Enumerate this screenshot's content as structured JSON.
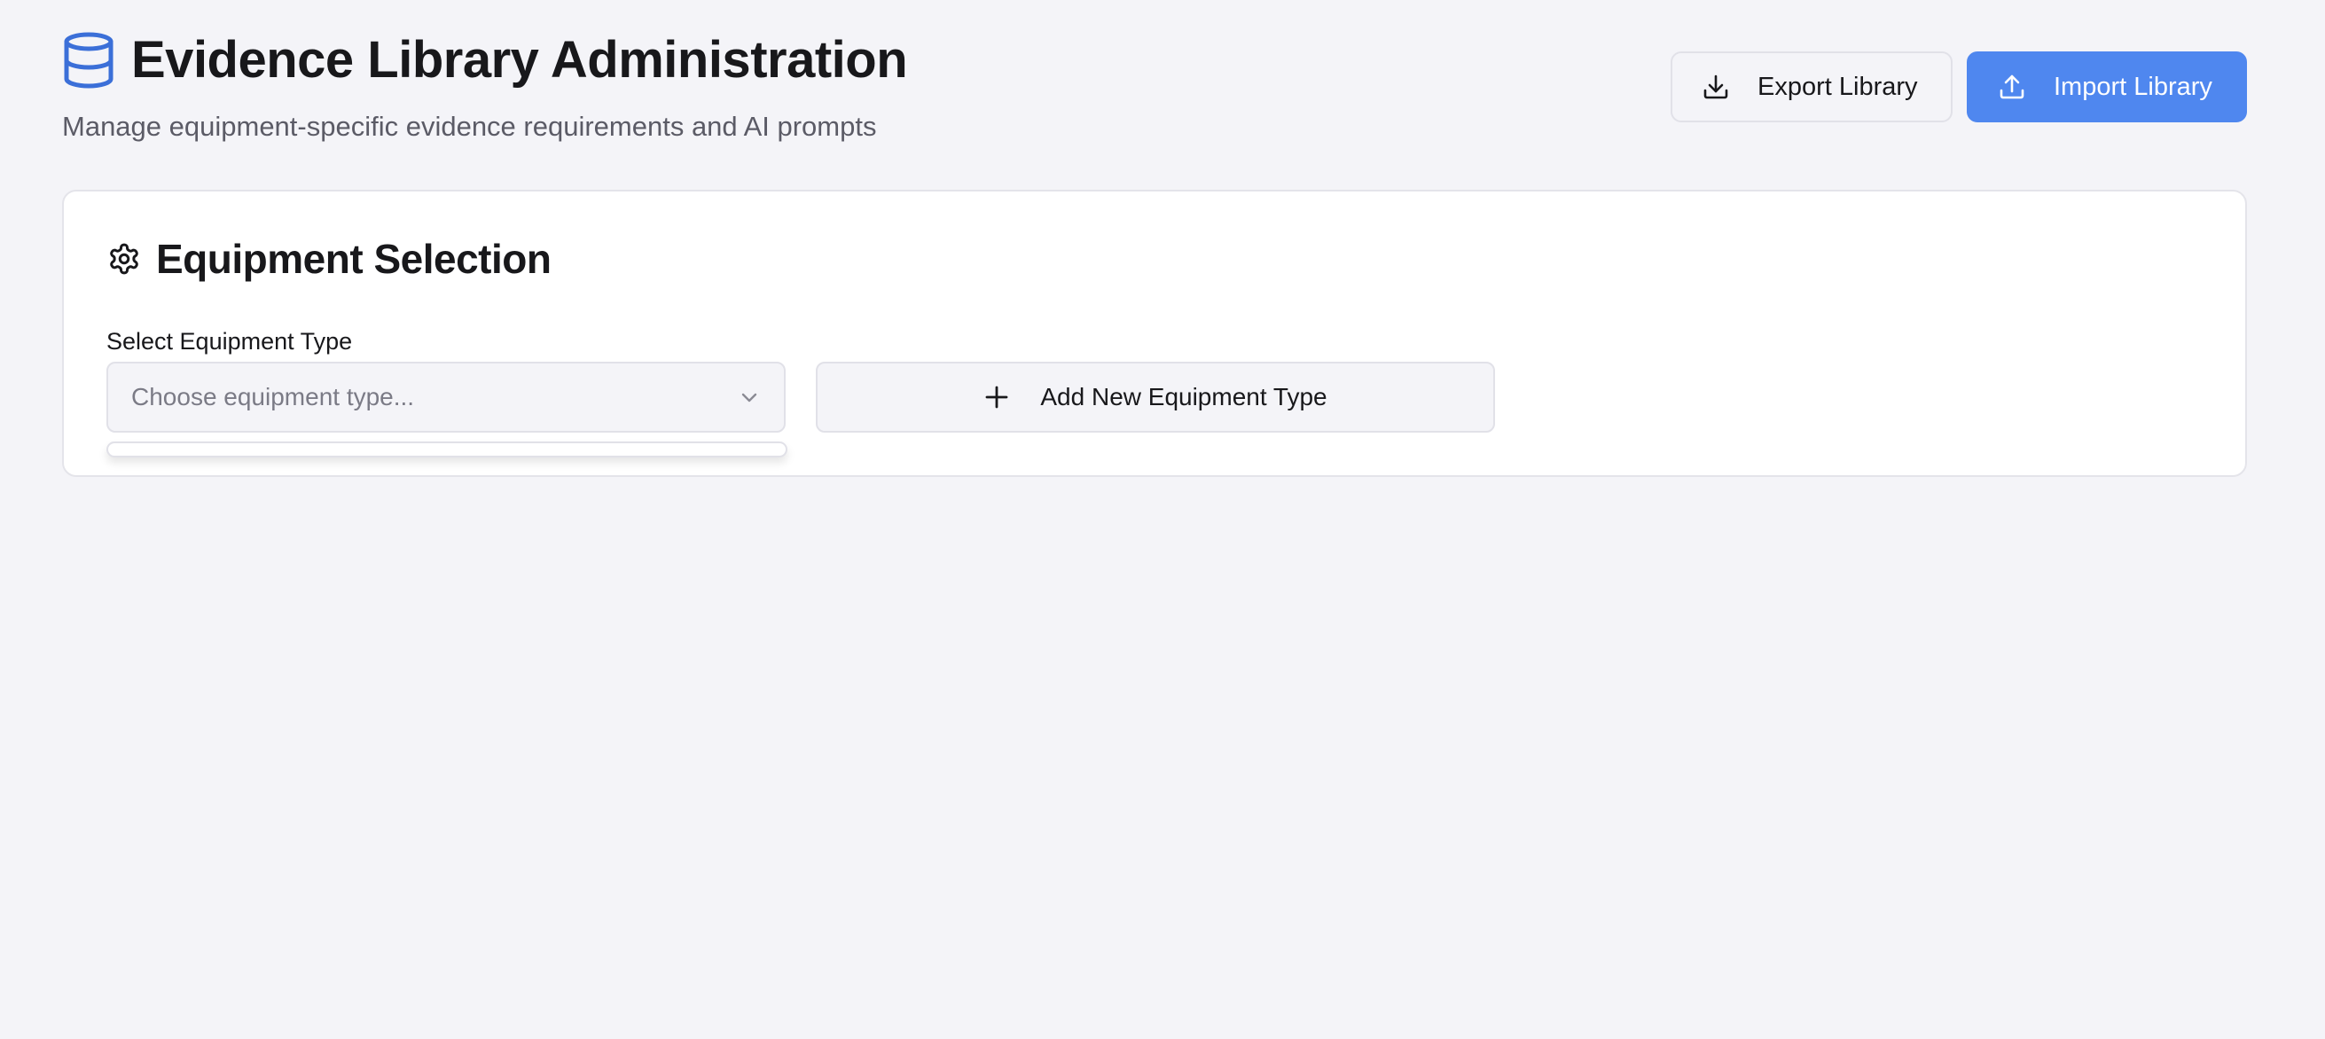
{
  "header": {
    "icon": "database-icon",
    "title": "Evidence Library Administration",
    "subtitle": "Manage equipment-specific evidence requirements and AI prompts",
    "accent_color": "#3b6fd8"
  },
  "actions": {
    "export": {
      "label": "Export Library",
      "icon": "download-icon"
    },
    "import": {
      "label": "Import Library",
      "icon": "upload-icon",
      "color": "#4f87ef"
    }
  },
  "equipment_selection": {
    "icon": "gear-icon",
    "title": "Equipment Selection",
    "select_label": "Select Equipment Type",
    "select_placeholder": "Choose equipment type...",
    "select_icon": "chevron-down-icon",
    "dropdown_options": [],
    "add_button": {
      "label": "Add New Equipment Type",
      "icon": "plus-icon"
    }
  }
}
